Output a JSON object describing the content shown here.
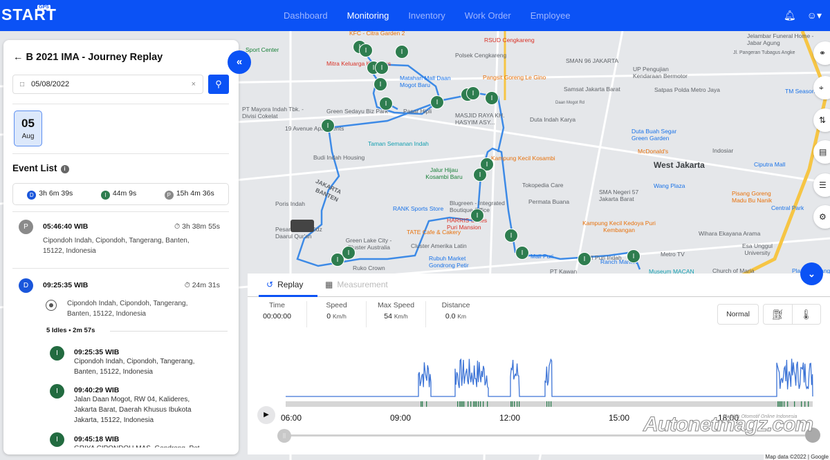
{
  "topbar": {
    "logo": "START",
    "logo_badge": "GPS",
    "nav": [
      "Dashboard",
      "Monitoring",
      "Inventory",
      "Work Order",
      "Employee"
    ],
    "active_nav": "Monitoring",
    "icons": [
      "bell-icon",
      "user-icon"
    ]
  },
  "sidepanel": {
    "title": "B 2021 IMA - Journey Replay",
    "date_value": "05/08/2022",
    "day_card": {
      "day": "05",
      "month": "Aug"
    },
    "event_list_title": "Event List",
    "summary": [
      {
        "badge": "D",
        "value": "3h 6m 39s"
      },
      {
        "badge": "I",
        "value": "44m 9s"
      },
      {
        "badge": "P",
        "value": "15h 4m 36s"
      }
    ],
    "events": [
      {
        "badge": "P",
        "time": "05:46:40 WIB",
        "duration": "3h 38m 55s",
        "address_1": "Cipondoh Indah, Cipondoh, Tangerang, Banten,",
        "address_2": "15122, Indonesia"
      },
      {
        "badge": "D",
        "time": "09:25:35 WIB",
        "duration": "24m 31s",
        "address_1": "Cipondoh Indah, Cipondoh, Tangerang,",
        "address_2": "Banten, 15122, Indonesia"
      }
    ],
    "idles_header": "5 Idles • 2m 57s",
    "idles": [
      {
        "badge": "I",
        "time": "09:25:35 WIB",
        "lines": [
          "Cipondoh Indah, Cipondoh, Tangerang,",
          "Banten, 15122, Indonesia"
        ]
      },
      {
        "badge": "I",
        "time": "09:40:29 WIB",
        "lines": [
          "Jalan Daan Mogot, RW 04, Kalideres,",
          "Jakarta Barat, Daerah Khusus Ibukota",
          "Jakarta, 15122, Indonesia"
        ]
      },
      {
        "badge": "I",
        "time": "09:45:18 WIB",
        "lines": [
          "GRIYA CIPONDOH MAS, Gondrong, Pet..."
        ]
      }
    ]
  },
  "map": {
    "labels": [
      {
        "t": "KFC - Citra Garden 2",
        "c": "orange"
      },
      {
        "t": "RSUD Cengkareng",
        "c": "red"
      },
      {
        "t": "Polsek Cengkareng",
        "c": ""
      },
      {
        "t": "SMAN 96 JAKARTA",
        "c": ""
      },
      {
        "t": "Jelambar Funeral Home - Jabar Agung",
        "c": ""
      },
      {
        "t": "Jl. Pangeran Tubagus Angke",
        "c": ""
      },
      {
        "t": "UP Pengujian Kendaraan Bermotor",
        "c": ""
      },
      {
        "t": "Sport Center",
        "c": "green"
      },
      {
        "t": "Mitra Keluarga Kalideres",
        "c": "red"
      },
      {
        "t": "Matahari Mall Daan Mogot Baru",
        "c": "blue"
      },
      {
        "t": "Pangsit Goreng Le Gino",
        "c": "orange"
      },
      {
        "t": "Samsat Jakarta Barat",
        "c": ""
      },
      {
        "t": "Satpas Polda Metro Jaya",
        "c": ""
      },
      {
        "t": "TM Season City",
        "c": "blue"
      },
      {
        "t": "PT Mayora Indah Tbk. - Divisi Cokelat",
        "c": ""
      },
      {
        "t": "Green Sedayu Biz Park",
        "c": ""
      },
      {
        "t": "Pasar Hipli",
        "c": ""
      },
      {
        "t": "MASJID RAYA KH. HASYIM ASY...",
        "c": ""
      },
      {
        "t": "Duta Indah Karya",
        "c": ""
      },
      {
        "t": "Daan Mogot Rd",
        "c": ""
      },
      {
        "t": "19 Avenue Apartments",
        "c": ""
      },
      {
        "t": "Duta Buah Segar Green Garden",
        "c": "blue"
      },
      {
        "t": "Taman Semanan Indah",
        "c": "teal"
      },
      {
        "t": "McDonald's",
        "c": "orange"
      },
      {
        "t": "Indosiar",
        "c": ""
      },
      {
        "t": "Ciputra Mall",
        "c": "blue"
      },
      {
        "t": "West Jakarta",
        "c": "big"
      },
      {
        "t": "Budi Indah Housing",
        "c": ""
      },
      {
        "t": "Kampung Kecil Kosambi",
        "c": "orange"
      },
      {
        "t": "Jalur Hijau Kosambi Baru",
        "c": "green"
      },
      {
        "t": "Tokopedia Care",
        "c": ""
      },
      {
        "t": "SMA Negeri 57 Jakarta Barat",
        "c": ""
      },
      {
        "t": "Wang Plaza",
        "c": "blue"
      },
      {
        "t": "Pisang Goreng Madu Bu Nanik",
        "c": "orange"
      },
      {
        "t": "Poris Indah",
        "c": ""
      },
      {
        "t": "Permata Buana",
        "c": ""
      },
      {
        "t": "Central Park",
        "c": "blue"
      },
      {
        "t": "Blugreen - Integrated Boutique Office",
        "c": ""
      },
      {
        "t": "RANK Sports Store",
        "c": "blue"
      },
      {
        "t": "HARRIS Suites Puri Mansion",
        "c": "red"
      },
      {
        "t": "Kampung Kecil Kedoya Puri Kembangan",
        "c": "orange"
      },
      {
        "t": "Wihara Ekayana Arama",
        "c": ""
      },
      {
        "t": "Pesantren Tahfidz Daarul Qur'an",
        "c": ""
      },
      {
        "t": "TATE Cafe & Cakery",
        "c": "orange"
      },
      {
        "t": "Green Lake City - Cluster Australia",
        "c": ""
      },
      {
        "t": "Cluster Amerika Latin",
        "c": ""
      },
      {
        "t": "Esa Unggul University",
        "c": ""
      },
      {
        "t": "Mall Puri Indah",
        "c": ""
      },
      {
        "t": "Rubuh Market Gondrong Petir",
        "c": "blue"
      },
      {
        "t": "Ruko Crown",
        "c": ""
      },
      {
        "t": "Mall Puri",
        "c": "blue"
      },
      {
        "t": "Ranch Market",
        "c": "blue"
      },
      {
        "t": "Metro TV",
        "c": ""
      },
      {
        "t": "PT Kawan",
        "c": ""
      },
      {
        "t": "Museum MACAN",
        "c": "teal"
      },
      {
        "t": "Church of Maria",
        "c": ""
      },
      {
        "t": "Plaza Semanggi",
        "c": "blue"
      },
      {
        "t": "JAKARTA",
        "c": ""
      },
      {
        "t": "BANTEN",
        "c": ""
      }
    ],
    "attribution": "Map data ©2022 | Google",
    "right_tools": [
      "route-points-icon",
      "map-pin-icon",
      "route-icon",
      "report-icon",
      "layers-icon",
      "settings-icon"
    ]
  },
  "replay": {
    "tabs": [
      {
        "label": "Replay",
        "active": true
      },
      {
        "label": "Measurement",
        "active": false
      }
    ],
    "stats": [
      {
        "label": "Time",
        "value": "00:00:00",
        "unit": ""
      },
      {
        "label": "Speed",
        "value": "0",
        "unit": "Km/h"
      },
      {
        "label": "Max Speed",
        "value": "54",
        "unit": "Km/h"
      },
      {
        "label": "Distance",
        "value": "0.0",
        "unit": "Km"
      }
    ],
    "mode": "Normal",
    "timeline_ticks": [
      "06:00",
      "09:00",
      "12:00",
      "15:00",
      "18:00"
    ],
    "progress": 0
  },
  "watermark": {
    "main": "Autonetmagz.com",
    "sub": "Majalah Otomotif Online Indonesia"
  }
}
